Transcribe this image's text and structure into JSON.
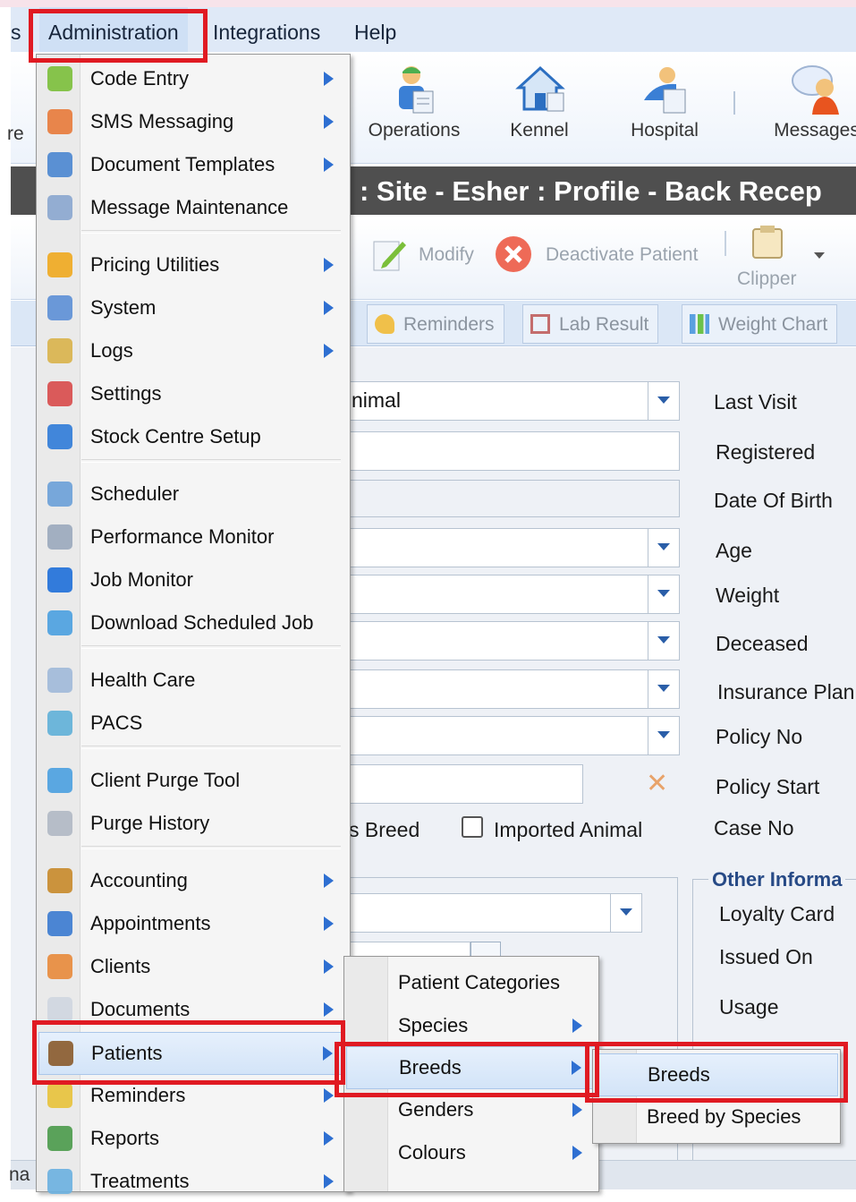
{
  "menubar": {
    "left_fragment": "s",
    "items": [
      "Administration",
      "Integrations",
      "Help"
    ]
  },
  "toolbar": {
    "left_fragment": "re",
    "buttons": [
      {
        "label": "Operations",
        "icon": "operations-person-icon"
      },
      {
        "label": "Kennel",
        "icon": "kennel-house-icon"
      },
      {
        "label": "Hospital",
        "icon": "hospital-icon"
      },
      {
        "label": "Messages",
        "icon": "messages-person-icon"
      }
    ]
  },
  "title_bar": {
    "text": ": Site - Esher : Profile - Back Recep"
  },
  "action_toolbar": {
    "modify": "Modify",
    "deactivate": "Deactivate Patient",
    "clipper": "Clipper"
  },
  "tabs": [
    "Reminders",
    "Lab Result",
    "Weight Chart"
  ],
  "form": {
    "animal_fragment": "nimal",
    "breed_fragment": "s Breed",
    "imported_animal": "Imported Animal",
    "right_labels": [
      "Last Visit",
      "Registered",
      "Date Of Birth",
      "Age",
      "Weight",
      "Deceased",
      "Insurance Plan",
      "Policy No",
      "Policy Start",
      "Case No"
    ],
    "other_info_legend": "Other Informa",
    "other_info_labels": [
      "Loyalty Card",
      "Issued On",
      "Usage"
    ],
    "bottom_fragment": "na"
  },
  "admin_menu": {
    "items": [
      {
        "label": "Code Entry",
        "icon": "code-entry-icon",
        "submenu": true
      },
      {
        "label": "SMS Messaging",
        "icon": "phone-icon",
        "submenu": true
      },
      {
        "label": "Document Templates",
        "icon": "document-template-icon",
        "submenu": true
      },
      {
        "label": "Message Maintenance",
        "icon": "message-maintenance-icon",
        "submenu": false
      },
      {
        "label": "Pricing Utilities",
        "icon": "pricing-icon",
        "submenu": true
      },
      {
        "label": "System",
        "icon": "system-icon",
        "submenu": true
      },
      {
        "label": "Logs",
        "icon": "logs-icon",
        "submenu": true
      },
      {
        "label": "Settings",
        "icon": "settings-checklist-icon",
        "submenu": false
      },
      {
        "label": "Stock Centre Setup",
        "icon": "stock-centre-icon",
        "submenu": false
      },
      {
        "label": "Scheduler",
        "icon": "scheduler-icon",
        "submenu": false
      },
      {
        "label": "Performance Monitor",
        "icon": "performance-gear-icon",
        "submenu": false
      },
      {
        "label": "Job Monitor",
        "icon": "job-monitor-info-icon",
        "submenu": false
      },
      {
        "label": "Download Scheduled Job",
        "icon": "download-schedule-icon",
        "submenu": false
      },
      {
        "label": "Health Care",
        "icon": "health-care-icon",
        "submenu": false
      },
      {
        "label": "PACS",
        "icon": "pacs-image-icon",
        "submenu": false
      },
      {
        "label": "Client Purge Tool",
        "icon": "client-purge-icon",
        "submenu": false
      },
      {
        "label": "Purge History",
        "icon": "purge-history-icon",
        "submenu": false
      },
      {
        "label": "Accounting",
        "icon": "accounting-moneybag-icon",
        "submenu": true
      },
      {
        "label": "Appointments",
        "icon": "appointments-calendar-icon",
        "submenu": true
      },
      {
        "label": "Clients",
        "icon": "clients-people-icon",
        "submenu": true
      },
      {
        "label": "Documents",
        "icon": "documents-icon",
        "submenu": true
      },
      {
        "label": "Patients",
        "icon": "patients-horse-icon",
        "submenu": true
      },
      {
        "label": "Reminders",
        "icon": "reminders-bell-icon",
        "submenu": true
      },
      {
        "label": "Reports",
        "icon": "reports-icon",
        "submenu": true
      },
      {
        "label": "Treatments",
        "icon": "treatments-icon",
        "submenu": true
      }
    ]
  },
  "patients_menu": {
    "items": [
      {
        "label": "Patient Categories",
        "submenu": false
      },
      {
        "label": "Species",
        "submenu": true
      },
      {
        "label": "Breeds",
        "submenu": true
      },
      {
        "label": "Genders",
        "submenu": true
      },
      {
        "label": "Colours",
        "submenu": true
      }
    ]
  },
  "breeds_menu": {
    "items": [
      {
        "label": "Breeds"
      },
      {
        "label": "Breed by Species"
      }
    ]
  },
  "colors": {
    "highlight_red": "#e01a22",
    "menu_bg": "#f5f5f5",
    "title_bar_bg": "#4f4f4f",
    "submenu_arrow": "#2e6fd1"
  }
}
